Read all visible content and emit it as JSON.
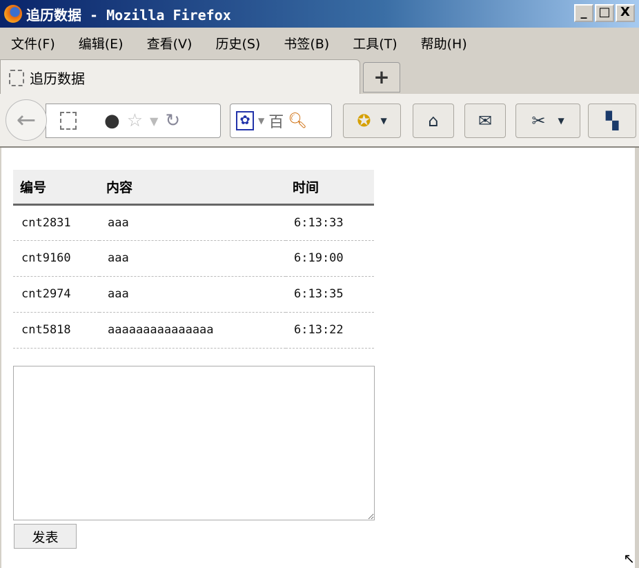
{
  "window": {
    "title": "追历数据 - Mozilla Firefox",
    "minimize": "_",
    "maximize": "□",
    "close": "X"
  },
  "menu": [
    "文件(F)",
    "编辑(E)",
    "查看(V)",
    "历史(S)",
    "书签(B)",
    "工具(T)",
    "帮助(H)"
  ],
  "tab": {
    "label": "追历数据",
    "new_tab": "+"
  },
  "search": {
    "engine_char": "百"
  },
  "table": {
    "headers": [
      "编号",
      "内容",
      "时间"
    ],
    "rows": [
      [
        "cnt2831",
        "aaa",
        "6:13:33"
      ],
      [
        "cnt9160",
        "aaa",
        "6:19:00"
      ],
      [
        "cnt2974",
        "aaa",
        "6:13:35"
      ],
      [
        "cnt5818",
        "aaaaaaaaaaaaaaa",
        "6:13:22"
      ]
    ]
  },
  "form": {
    "textarea_value": "",
    "submit_label": "发表"
  }
}
